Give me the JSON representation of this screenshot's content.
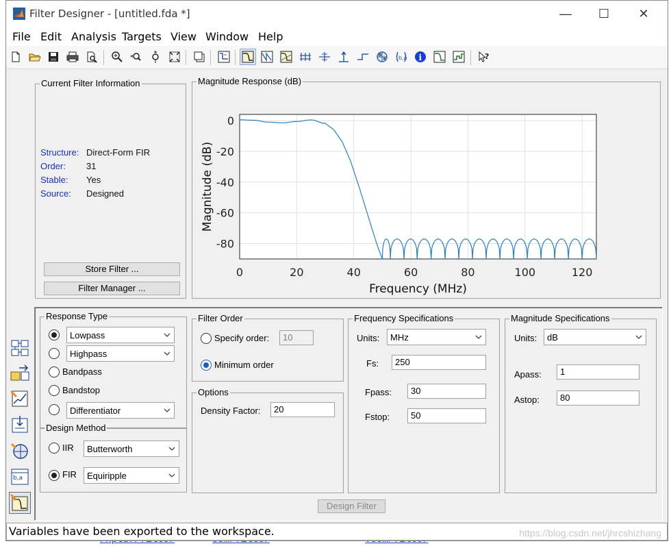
{
  "window": {
    "title": "Filter Designer -  [untitled.fda *]",
    "minimize": "—",
    "maximize": "☐",
    "close": "✕"
  },
  "menu": [
    "File",
    "Edit",
    "Analysis",
    "Targets",
    "View",
    "Window",
    "Help"
  ],
  "toolbar_icons": [
    "new-file-icon",
    "open-folder-icon",
    "save-icon",
    "print-icon",
    "print-preview-icon",
    "zoom-in-icon",
    "zoom-x-icon",
    "zoom-y-icon",
    "full-view-icon",
    "new-window-icon",
    "filter-specs-icon",
    "magnitude-response-icon",
    "phase-response-icon",
    "magnitude-phase-icon",
    "group-delay-icon",
    "phase-delay-icon",
    "impulse-response-icon",
    "step-response-icon",
    "pole-zero-icon",
    "coefficients-icon",
    "info-icon",
    "magnitude-estimate-icon",
    "round-off-noise-icon",
    "whats-this-icon"
  ],
  "current_filter": {
    "title": "Current Filter Information",
    "rows": [
      {
        "label": "Structure:",
        "value": "Direct-Form FIR"
      },
      {
        "label": "Order:",
        "value": "31"
      },
      {
        "label": "Stable:",
        "value": "Yes"
      },
      {
        "label": "Source:",
        "value": "Designed"
      }
    ],
    "store_button": "Store Filter ...",
    "manager_button": "Filter Manager ..."
  },
  "chart_panel_title": "Magnitude Response (dB)",
  "chart_data": {
    "type": "line",
    "xlabel": "Frequency (MHz)",
    "ylabel": "Magnitude (dB)",
    "xlim": [
      0,
      125
    ],
    "ylim": [
      -90,
      4
    ],
    "xticks": [
      0,
      20,
      40,
      60,
      80,
      100,
      120
    ],
    "yticks": [
      0,
      -20,
      -40,
      -60,
      -80
    ],
    "grid": true,
    "color": "#2a7fc0",
    "series": [
      {
        "x": [
          0,
          5,
          10,
          15,
          20,
          25,
          30,
          33,
          36,
          39,
          42,
          45,
          48,
          50
        ],
        "values": [
          0.5,
          0.2,
          -1.0,
          -1.5,
          -0.6,
          0.4,
          -1.8,
          -6,
          -14,
          -27,
          -44,
          -62,
          -80,
          -90
        ]
      }
    ],
    "stopband": {
      "start": 50,
      "end": 125,
      "ripple_peak": -77,
      "floor": -90,
      "lobes": [
        50.0,
        52.8,
        57.6,
        62.2,
        67.1,
        72.0,
        76.8,
        81.6,
        86.4,
        91.2,
        96.0,
        100.8,
        105.6,
        110.4,
        115.2,
        120.0,
        125.0
      ]
    }
  },
  "response_type": {
    "title": "Response Type",
    "lowpass": "Lowpass",
    "highpass": "Highpass",
    "bandpass": "Bandpass",
    "bandstop": "Bandstop",
    "differentiator": "Differentiator",
    "selected": "Lowpass"
  },
  "design_method": {
    "title": "Design Method",
    "iir_label": "IIR",
    "iir_value": "Butterworth",
    "fir_label": "FIR",
    "fir_value": "Equiripple",
    "selected": "FIR"
  },
  "filter_order": {
    "title": "Filter Order",
    "specify_label": "Specify order:",
    "specify_value": "10",
    "minimum_label": "Minimum order",
    "selected": "Minimum order"
  },
  "options": {
    "title": "Options",
    "density_label": "Density Factor:",
    "density_value": "20"
  },
  "freq_specs": {
    "title": "Frequency Specifications",
    "units_label": "Units:",
    "units_value": "MHz",
    "fs_label": "Fs:",
    "fs_value": "250",
    "fpass_label": "Fpass:",
    "fpass_value": "30",
    "fstop_label": "Fstop:",
    "fstop_value": "50"
  },
  "mag_specs": {
    "title": "Magnitude Specifications",
    "units_label": "Units:",
    "units_value": "dB",
    "apass_label": "Apass:",
    "apass_value": "1",
    "astop_label": "Astop:",
    "astop_value": "80"
  },
  "design_button": "Design Filter",
  "status": "Variables have been exported to the workspace.",
  "watermark": "https://blog.csdn.net/jhrcshizhang",
  "background_code": [
    "Fxptdf/filter",
    "ssm/filter",
    "veem/filter"
  ]
}
